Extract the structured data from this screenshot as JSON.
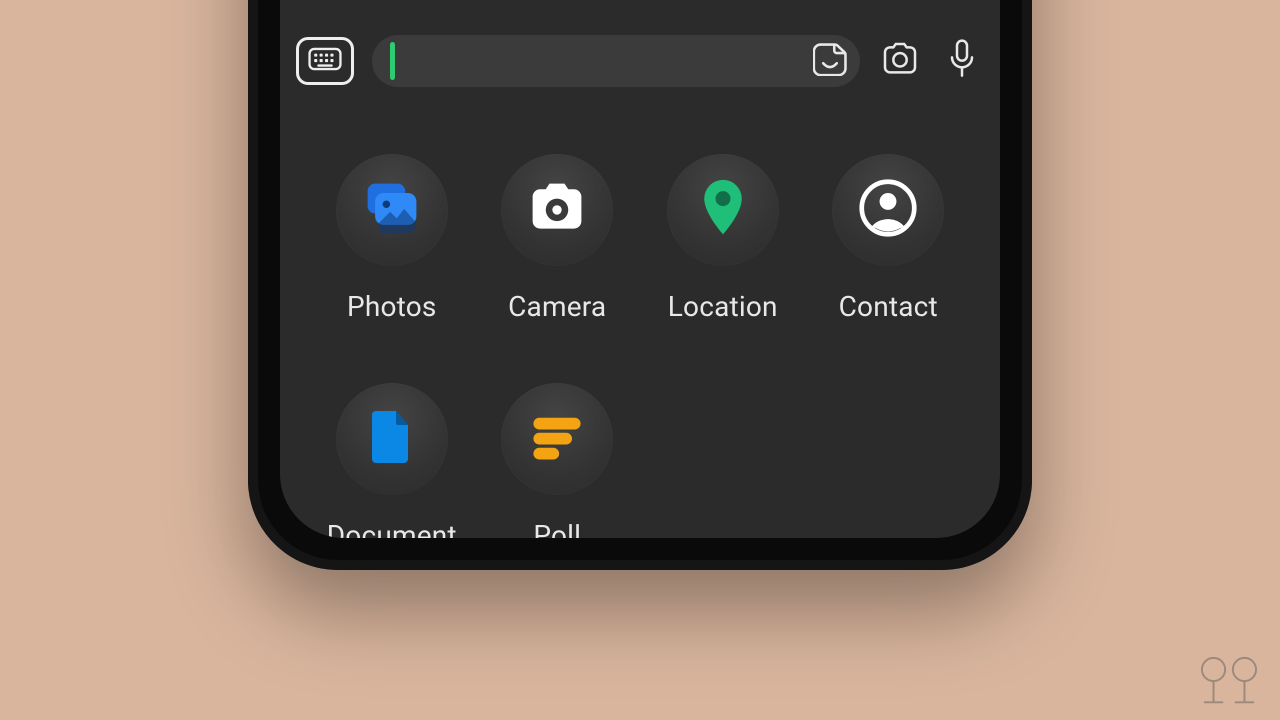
{
  "input_row": {
    "keyboard_icon": "keyboard-icon",
    "message_value": "",
    "message_placeholder": "",
    "sticker_icon": "sticker-icon",
    "camera_icon": "camera-icon",
    "mic_icon": "microphone-icon"
  },
  "attachments": [
    {
      "id": "photos",
      "label": "Photos",
      "icon": "gallery-icon",
      "icon_color": "#2f8af7"
    },
    {
      "id": "camera",
      "label": "Camera",
      "icon": "camera-icon",
      "icon_color": "#ffffff"
    },
    {
      "id": "location",
      "label": "Location",
      "icon": "map-pin-icon",
      "icon_color": "#1fbf79"
    },
    {
      "id": "contact",
      "label": "Contact",
      "icon": "contact-icon",
      "icon_color": "#ffffff"
    },
    {
      "id": "document",
      "label": "Document",
      "icon": "document-icon",
      "icon_color": "#0b87e6"
    },
    {
      "id": "poll",
      "label": "Poll",
      "icon": "poll-icon",
      "icon_color": "#f4a413"
    }
  ],
  "colors": {
    "accent_cursor": "#2ecc71",
    "blue": "#2f8af7",
    "green": "#1fbf79",
    "orange": "#f4a413",
    "doc_blue": "#0b87e6"
  }
}
